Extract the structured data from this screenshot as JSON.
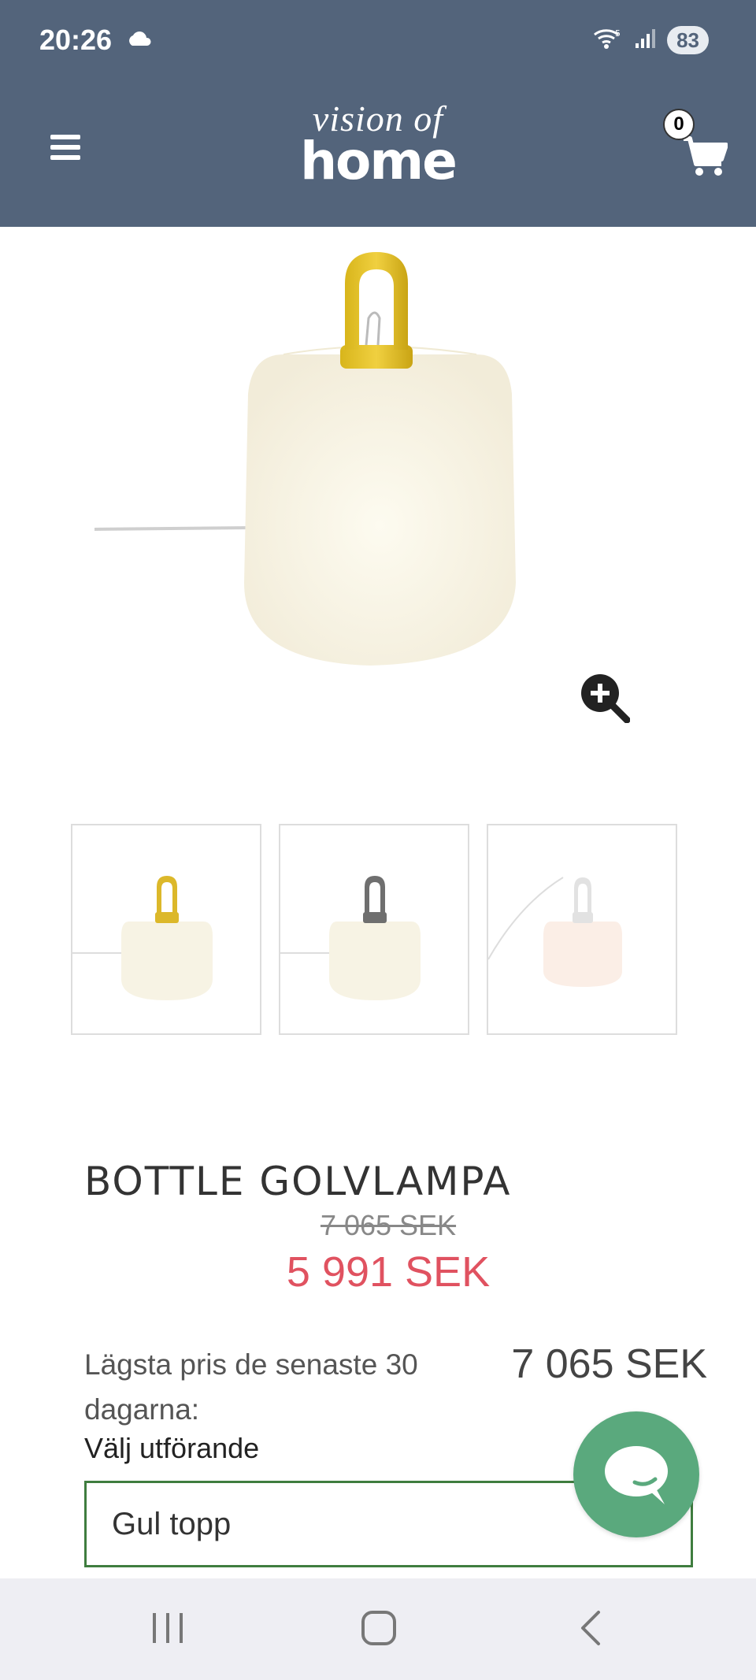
{
  "status_bar": {
    "time": "20:26",
    "battery": "83",
    "icons": [
      "cloud-icon",
      "wifi-icon",
      "signal-icon"
    ]
  },
  "header": {
    "logo_line1": "vision of",
    "logo_line2": "home",
    "cart_count": "0",
    "background_color": "#53647b"
  },
  "gallery": {
    "thumbnails": [
      {
        "variant": "yellow-top",
        "handle_color": "#e3c12c"
      },
      {
        "variant": "grey-top",
        "handle_color": "#6f6f6f"
      },
      {
        "variant": "white-top",
        "handle_color": "#dedede"
      }
    ]
  },
  "product": {
    "title": "BOTTLE GOLVLAMPA",
    "old_price": "7 065 SEK",
    "new_price": "5 991 SEK",
    "lowest_price_label": "Lägsta pris de senaste 30 dagarna:",
    "lowest_price_value": "7 065 SEK",
    "variant_label": "Välj utförande",
    "variant_selected": "Gul topp",
    "sale_color": "#e05260",
    "select_border_color": "#3f7d3f"
  },
  "chat": {
    "color": "#5aa97d"
  },
  "nav_bar": {
    "buttons": [
      "recent-apps",
      "home",
      "back"
    ]
  }
}
